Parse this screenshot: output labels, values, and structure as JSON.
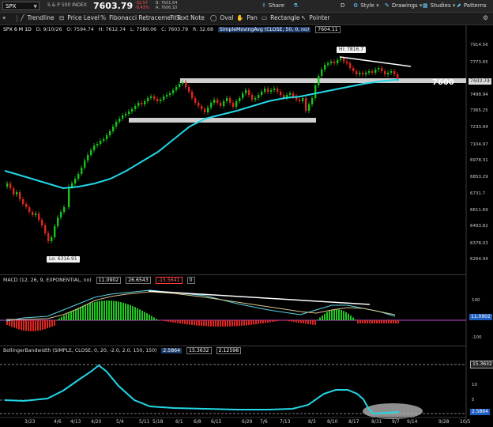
{
  "topbar": {
    "symbol": "SPX",
    "symbol_name": "S & P 500 INDEX",
    "last_price": "7603.79",
    "change_abs": "-32.57",
    "change_pct": "-0.43%",
    "bid": "B: 7601.64",
    "ask": "A: 7606.10",
    "share": "Share",
    "style": "Style",
    "drawings": "Drawings",
    "studies": "Studies",
    "patterns": "Patterns",
    "period_d": "D"
  },
  "drawing_toolbar": {
    "trendline": "Trendline",
    "price_level": "Price Level",
    "fibonacci": "Fibonacci Retracements",
    "text_note": "Text Note",
    "oval": "Oval",
    "pan": "Pan",
    "rectangle": "Rectangle",
    "pointer": "Pointer"
  },
  "price_panel": {
    "title": "SPX 6 M 1D",
    "date": "D: 9/10/26",
    "open": "O: 7594.74",
    "high": "H: 7612.74",
    "low": "L: 7580.06",
    "close": "C: 7603.79",
    "range": "R: 32.68",
    "sma_label": "SimpleMovingAvg (CLOSE, 50, 0, no)",
    "sma_value": "7604.11",
    "y_ticks": [
      "7914.56",
      "7773.65",
      "7638.98",
      "7498.94",
      "7365.25",
      "7233.94",
      "7104.97",
      "6978.31",
      "6853.29",
      "6731.7",
      "6611.69",
      "6493.82",
      "6378.03",
      "6264.94"
    ],
    "last_tag": "7603.79",
    "hi_annotation": "Hi: 7816.7",
    "lo_annotation": "Lo: 6316.91",
    "level_label": "7600",
    "colors": {
      "up": "#19c219",
      "down": "#e0271f",
      "sma": "#23d7e6",
      "zone": "#c9c9c9"
    }
  },
  "macd_panel": {
    "label": "MACD (12, 26, 9, EXPONENTIAL, no)",
    "value1": "11.0902",
    "value2": "26.6543",
    "value3": "-15.5641",
    "value4": "0",
    "y_ticks": [
      "100",
      "0",
      "-100"
    ],
    "tag": "11.0902"
  },
  "bb_panel": {
    "label": "BollingerBandwidth (SIMPLE, CLOSE, 0, 20, -2.0, 2.0, 150, 150)",
    "value1": "2.5864",
    "value2": "15.3632",
    "value3": "2.12598",
    "y_ticks": [
      "10",
      "5"
    ],
    "tag_top": "15.3632",
    "tag_bottom": "2.5864"
  },
  "x_axis": [
    "3/23",
    "4/6",
    "4/13",
    "4/20",
    "5/4",
    "5/11",
    "5/18",
    "6/1",
    "6/8",
    "6/15",
    "6/29",
    "7/6",
    "7/13",
    "8/3",
    "8/10",
    "8/17",
    "8/31",
    "9/7",
    "9/14",
    "9/28",
    "10/5"
  ]
}
